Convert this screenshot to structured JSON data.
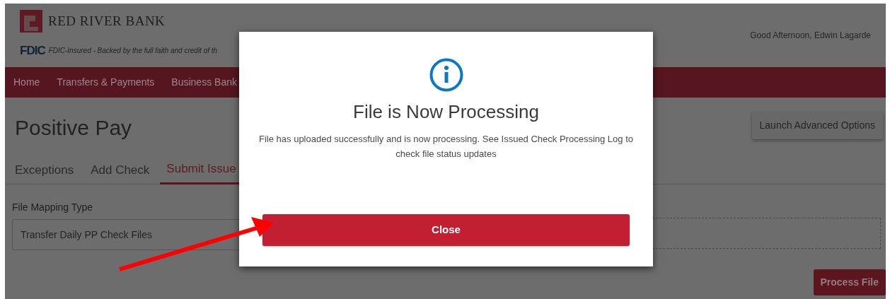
{
  "header": {
    "bank_name": "RED RIVER BANK",
    "fdic_mark": "FDIC",
    "fdic_text": "FDIC-Insured - Backed by the full faith and credit of th",
    "greeting": "Good Afternoon, Edwin Lagarde"
  },
  "nav": [
    "Home",
    "Transfers & Payments",
    "Business Bank"
  ],
  "page": {
    "title": "Positive Pay",
    "advanced_button": "Launch Advanced Options",
    "tabs": [
      {
        "label": "Exceptions",
        "selected": false
      },
      {
        "label": "Add Check",
        "selected": false
      },
      {
        "label": "Submit Issue",
        "selected": true
      }
    ],
    "field_label": "File Mapping Type",
    "field_value": "Transfer Daily PP Check Files",
    "process_button": "Process File"
  },
  "modal": {
    "title": "File is Now Processing",
    "message": "File has uploaded successfully and is now processing. See Issued Check Processing Log to check file status updates",
    "close_button": "Close"
  }
}
